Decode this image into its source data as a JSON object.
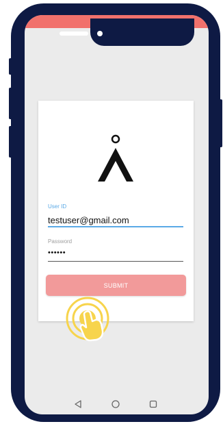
{
  "login": {
    "user_id_label": "User ID",
    "user_id_value": "testuser@gmail.com",
    "password_label": "Password",
    "password_value": "••••••",
    "submit_label": "SUBMIT"
  },
  "colors": {
    "status_bar": "#f1716c",
    "submit_button": "#f29a9a",
    "focus": "#5aa9e6",
    "tap_indicator": "#f7d44c"
  },
  "icons": [
    "logo-icon",
    "tap-gesture-icon",
    "back-icon",
    "home-icon",
    "recents-icon"
  ]
}
